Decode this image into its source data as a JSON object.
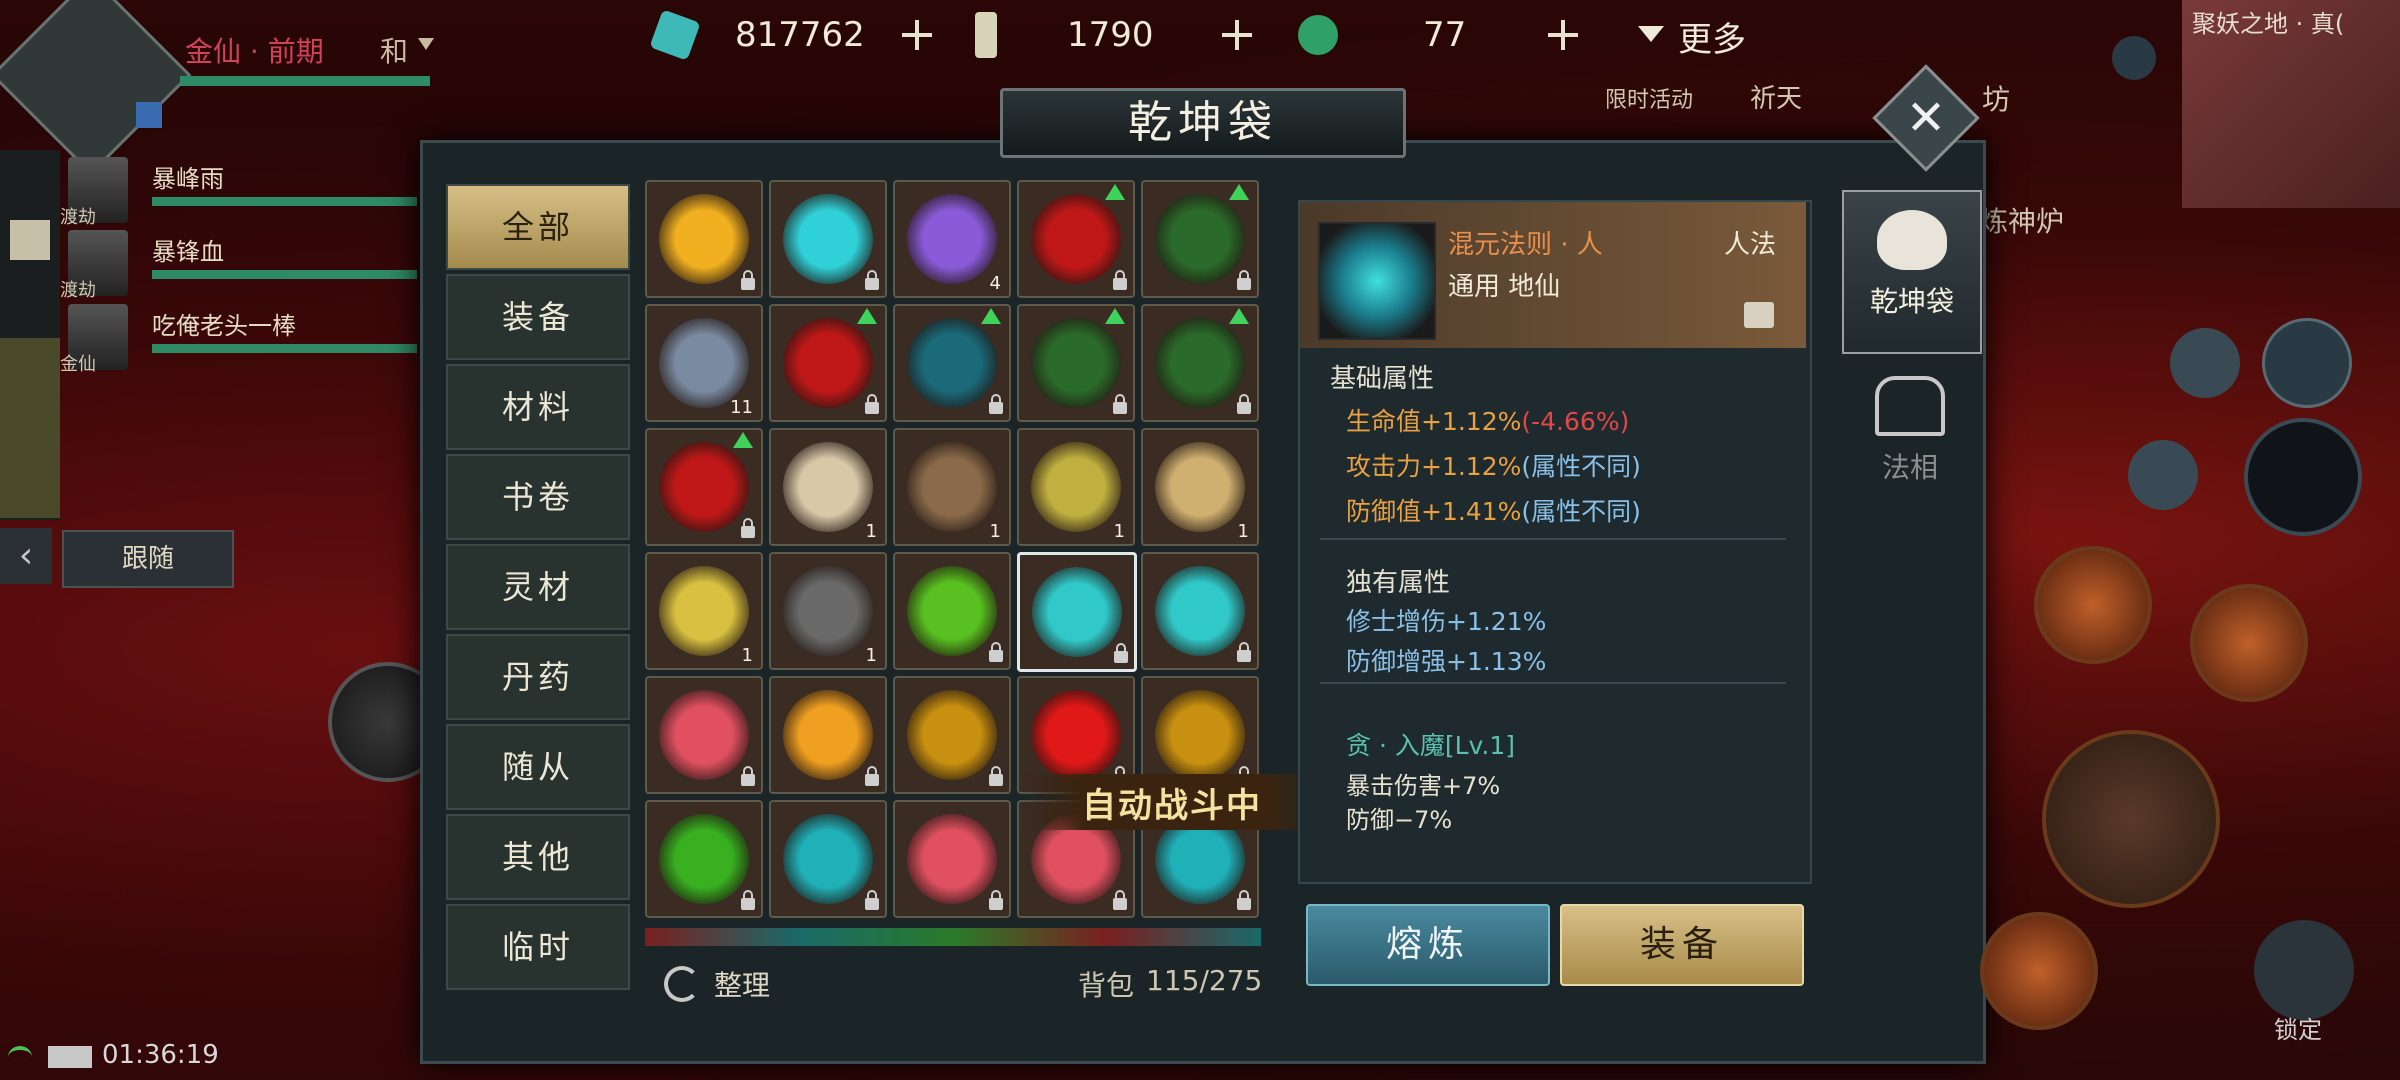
{
  "player": {
    "realm": "金仙 · 前期",
    "extra": "和"
  },
  "currency": [
    {
      "icon": "jade-gem-icon",
      "value": "817762"
    },
    {
      "icon": "token-icon",
      "value": "1790"
    },
    {
      "icon": "green-ring-icon",
      "value": "77"
    }
  ],
  "more_label": "更多",
  "top_right_labels": [
    "限时活动",
    "祈天",
    "坊",
    "炼神炉"
  ],
  "map_label": "聚妖之地 · 真(",
  "party": [
    {
      "name": "暴峰雨",
      "tag": "渡劫"
    },
    {
      "name": "暴锋血",
      "tag": "渡劫"
    },
    {
      "name": "吃俺老头一棒",
      "tag": "金仙"
    }
  ],
  "follow_label": "跟随",
  "dialog_title": "乾坤袋",
  "categories": [
    "全部",
    "装备",
    "材料",
    "书卷",
    "灵材",
    "丹药",
    "随从",
    "其他",
    "临时"
  ],
  "grid": [
    {
      "c": "#f0b020",
      "lock": true
    },
    {
      "c": "#30d0d8",
      "lock": true
    },
    {
      "c": "#8a5ad8",
      "cnt": "4"
    },
    {
      "c": "#c01818",
      "lock": true,
      "up": true
    },
    {
      "c": "#2a6a2a",
      "lock": true,
      "up": true
    },
    {
      "c": "#7a8aa0",
      "cnt": "11"
    },
    {
      "c": "#c01818",
      "lock": true,
      "up": true
    },
    {
      "c": "#1a6a7a",
      "lock": true,
      "up": true
    },
    {
      "c": "#2a6a2a",
      "lock": true,
      "up": true
    },
    {
      "c": "#2a6a2a",
      "lock": true,
      "up": true
    },
    {
      "c": "#c01818",
      "lock": true,
      "up": true
    },
    {
      "c": "#d8c8a8",
      "cnt": "1"
    },
    {
      "c": "#8a6a4a",
      "cnt": "1"
    },
    {
      "c": "#c0b040",
      "cnt": "1"
    },
    {
      "c": "#d0b070",
      "cnt": "1"
    },
    {
      "c": "#d8c040",
      "cnt": "1"
    },
    {
      "c": "#6a6a6a",
      "cnt": "1"
    },
    {
      "c": "#58c020",
      "lock": true
    },
    {
      "c": "#30c8c8",
      "lock": true,
      "sel": true
    },
    {
      "c": "#30c8c8",
      "lock": true
    },
    {
      "c": "#e05060",
      "lock": true
    },
    {
      "c": "#f0a020",
      "lock": true
    },
    {
      "c": "#c89010",
      "lock": true
    },
    {
      "c": "#e01818",
      "lock": true
    },
    {
      "c": "#c89010",
      "lock": true
    },
    {
      "c": "#38b020",
      "lock": true
    },
    {
      "c": "#20b0b8",
      "lock": true
    },
    {
      "c": "#e05060",
      "lock": true
    },
    {
      "c": "#e05060",
      "lock": true,
      "up": true
    },
    {
      "c": "#20b0b8",
      "lock": true
    }
  ],
  "sort_label": "整理",
  "bag_label": "背包",
  "bag_count": "115/275",
  "auto_battle": "自动战斗中",
  "item": {
    "name": "混元法则 · 人",
    "type": "人法",
    "sub": "通用 地仙",
    "base_title": "基础属性",
    "base": [
      {
        "text": "生命值+1.12%",
        "diff": "(-4.66%)"
      },
      {
        "text": "攻击力+1.12%",
        "diff": "(属性不同)"
      },
      {
        "text": "防御值+1.41%",
        "diff": "(属性不同)"
      }
    ],
    "unique_title": "独有属性",
    "unique": [
      "修士增伤+1.21%",
      "防御增强+1.13%"
    ],
    "skill_title": "贪 · 入魔[Lv.1]",
    "skill": [
      "暴击伤害+7%",
      "防御−7%"
    ]
  },
  "buttons": {
    "smelt": "熔炼",
    "equip": "装备"
  },
  "side_tabs": [
    "乾坤袋",
    "法相"
  ],
  "lock_label": "锁定",
  "clock": "01:36:19"
}
